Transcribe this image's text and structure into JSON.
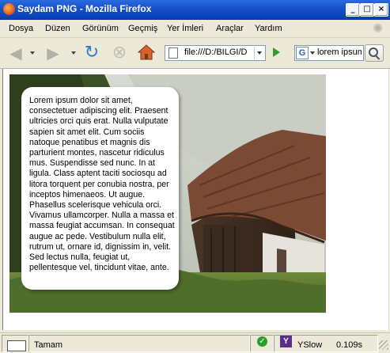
{
  "window": {
    "title": "Saydam PNG - Mozilla Firefox"
  },
  "menu": {
    "items": [
      {
        "label": "Dosya"
      },
      {
        "label": "Düzen"
      },
      {
        "label": "Görünüm"
      },
      {
        "label": "Geçmiş"
      },
      {
        "label": "Yer İmleri"
      },
      {
        "label": "Araçlar"
      },
      {
        "label": "Yardım"
      }
    ]
  },
  "toolbar": {
    "url": "file:///D:/BILGI/D",
    "search_value": "lorem ipsum",
    "search_engine_letter": "G"
  },
  "content": {
    "paragraph": "Lorem ipsum dolor sit amet, consectetuer adipiscing elit. Praesent ultricies orci quis erat. Nulla vulputate sapien sit amet elit. Cum sociis natoque penatibus et magnis dis parturient montes, nascetur ridiculus mus. Suspendisse sed nunc. In at ligula. Class aptent taciti sociosqu ad litora torquent per conubia nostra, per inceptos himenaeos. Ut augue. Phasellus scelerisque vehicula orci. Vivamus ullamcorper. Nulla a massa et massa feugiat accumsan. In consequat augue ac pede. Vestibulum nulla elit, rutrum ut, ornare id, dignissim in, velit. Sed lectus nulla, feugiat ut, pellentesque vel, tincidunt vitae, ante."
  },
  "status": {
    "text": "Tamam",
    "yslow_label": "YSlow",
    "load_time": "0.109s"
  }
}
